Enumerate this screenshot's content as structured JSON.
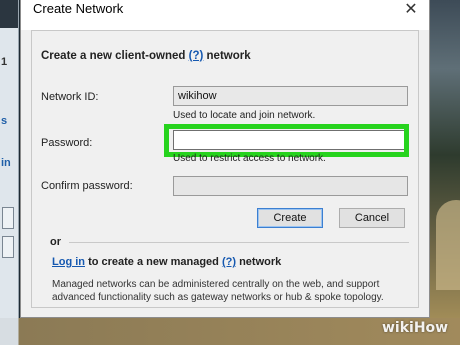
{
  "dialog": {
    "title": "Create Network",
    "close_glyph": "✕",
    "heading_prefix": "Create a new client-owned",
    "heading_help": "(?)",
    "heading_suffix": "network"
  },
  "fields": {
    "network_id": {
      "label": "Network ID:",
      "value": "wikihow",
      "hint": "Used to locate and join network."
    },
    "password": {
      "label": "Password:",
      "value": "",
      "hint": "Used to restrict access to network."
    },
    "confirm_password": {
      "label": "Confirm password:",
      "value": ""
    }
  },
  "buttons": {
    "create": "Create",
    "cancel": "Cancel"
  },
  "alternative": {
    "or_label": "or",
    "login_link": "Log in",
    "login_middle": "to create a new managed",
    "login_help": "(?)",
    "login_suffix": "network",
    "description": "Managed networks can be administered centrally on the web, and support advanced functionality such as gateway networks or hub & spoke topology."
  },
  "background_app": {
    "fragment_1": "1",
    "fragment_2": "s",
    "fragment_3": "in"
  },
  "watermark": "wikiHow",
  "colors": {
    "highlight": "#26d31d",
    "link": "#1558b0",
    "dialog_bg": "#f0f0f0"
  },
  "icons": {
    "close": "close-icon"
  }
}
